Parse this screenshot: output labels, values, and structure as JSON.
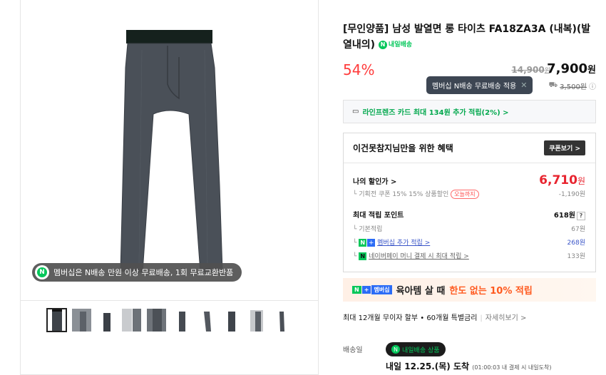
{
  "gallery": {
    "banner_text": "멤버십은 N배송 만원 이상 무료배송, 1회 무료교환반품",
    "banner_icon": "naver-membership-icon",
    "thumbnail_count": 11
  },
  "product": {
    "title": "[무인양품] 남성 발열면 롱 타이츠 FA18ZA3A (내복)(발열내의)",
    "tomorrow_badge": "내일배송",
    "discount": "54%",
    "original_price": "14,900",
    "original_price_unit": "원",
    "price": "7,900",
    "price_unit": "원"
  },
  "tooltip": {
    "text": "멤버십 N배송 무료배송 적용"
  },
  "shipping": {
    "fee": "3,500원"
  },
  "card": {
    "text": "라인프렌즈 카드 최대 134원 추가 적립(2%) >"
  },
  "benefit": {
    "title": "이건못참지님만을 위한 혜택",
    "coupon_button": "쿠폰보기 >",
    "my_price_label": "나의 할인가 >",
    "my_price": "6,710",
    "my_price_unit": "원",
    "coupon_text": "기획전 쿠폰 15% 15% 상품할인",
    "coupon_tag": "오늘까지",
    "coupon_value": "-1,190원",
    "points_label": "최대 적립 포인트",
    "points_value": "618원",
    "basic_label": "기본적립",
    "basic_value": "67원",
    "membership_label": "멤버십 추가 적립 >",
    "membership_value": "268원",
    "naverpay_label": "네이버페이 머니 결제 시 최대 적립 >",
    "naverpay_value": "133원"
  },
  "promo": {
    "badge_n": "N",
    "badge_plus": "+",
    "badge_label": "멤버십",
    "text_pre": "육아템 살 때",
    "text_highlight": "한도 없는 10% 적립"
  },
  "installment": {
    "text": "최대 12개월 무이자 할부 • 60개월 특별금리",
    "more": "자세히보기 >"
  },
  "delivery": {
    "label": "배송일",
    "badge": "내일배송 상품",
    "date": "내일 12.25.(목) 도착",
    "note": "(01:00:03 내 결제 시 내일도착)"
  },
  "colors": {
    "accent_red": "#e8242f",
    "naver_green": "#03c75a",
    "membership_blue": "#2b6cf6",
    "tooltip_bg": "#3d4653"
  }
}
